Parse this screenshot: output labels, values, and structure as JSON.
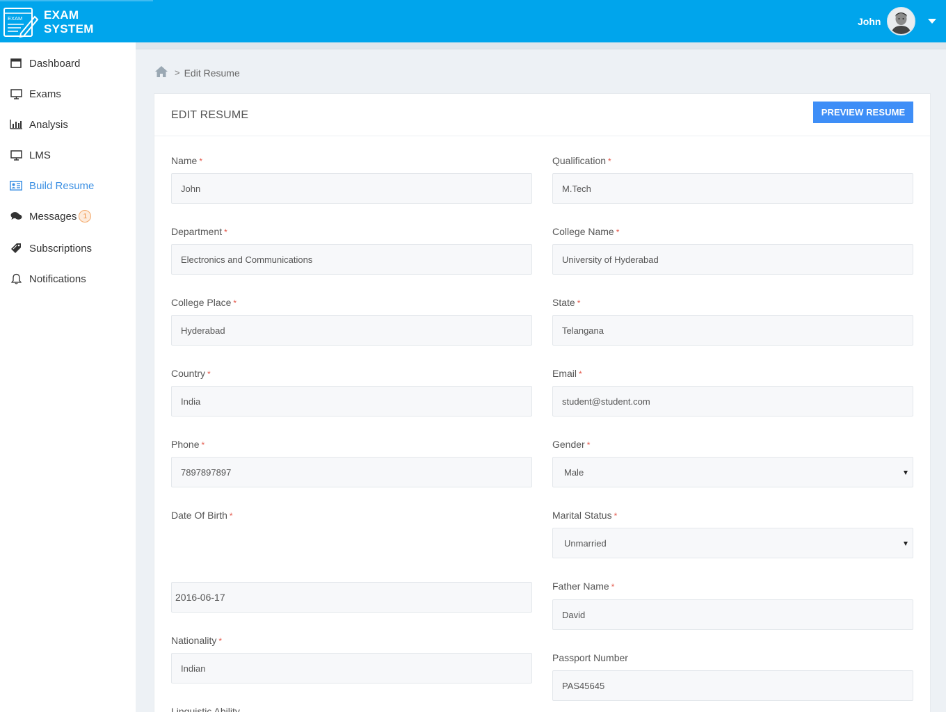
{
  "brand": {
    "line1": "EXAM",
    "line2": "SYSTEM",
    "logo_text": "EXAM"
  },
  "header": {
    "user_name": "John"
  },
  "sidebar": {
    "items": [
      {
        "label": "Dashboard",
        "icon": "window-icon"
      },
      {
        "label": "Exams",
        "icon": "monitor-icon"
      },
      {
        "label": "Analysis",
        "icon": "bar-chart-icon"
      },
      {
        "label": "LMS",
        "icon": "monitor-icon"
      },
      {
        "label": "Build Resume",
        "icon": "id-card-icon",
        "active": true
      },
      {
        "label": "Messages",
        "icon": "chat-icon",
        "badge": "1"
      },
      {
        "label": "Subscriptions",
        "icon": "tag-icon"
      },
      {
        "label": "Notifications",
        "icon": "bell-icon"
      }
    ]
  },
  "breadcrumb": {
    "sep": ">",
    "current": "Edit Resume"
  },
  "card": {
    "title": "EDIT RESUME",
    "preview_label": "PREVIEW RESUME"
  },
  "form": {
    "name": {
      "label": "Name",
      "value": "John"
    },
    "qualification": {
      "label": "Qualification",
      "value": "M.Tech"
    },
    "department": {
      "label": "Department",
      "value": "Electronics and Communications"
    },
    "college_name": {
      "label": "College Name",
      "value": "University of Hyderabad"
    },
    "college_place": {
      "label": "College Place",
      "value": "Hyderabad"
    },
    "state": {
      "label": "State",
      "value": "Telangana"
    },
    "country": {
      "label": "Country",
      "value": "India"
    },
    "email": {
      "label": "Email",
      "value": "student@student.com"
    },
    "phone": {
      "label": "Phone",
      "value": "7897897897"
    },
    "gender": {
      "label": "Gender",
      "value": "Male"
    },
    "dob": {
      "label": "Date Of Birth",
      "value": "2016-06-17"
    },
    "marital_status": {
      "label": "Marital Status",
      "value": "Unmarried"
    },
    "father_name": {
      "label": "Father Name",
      "value": "David"
    },
    "nationality": {
      "label": "Nationality",
      "value": "Indian"
    },
    "passport": {
      "label": "Passport Number",
      "value": "PAS45645"
    },
    "linguistic": {
      "label": "Linguistic Ability"
    },
    "required_mark": "*"
  },
  "colors": {
    "topbar": "#00a5ec",
    "accent": "#3e8ef7",
    "active_nav": "#3b8fe3",
    "required": "#e3584b"
  }
}
